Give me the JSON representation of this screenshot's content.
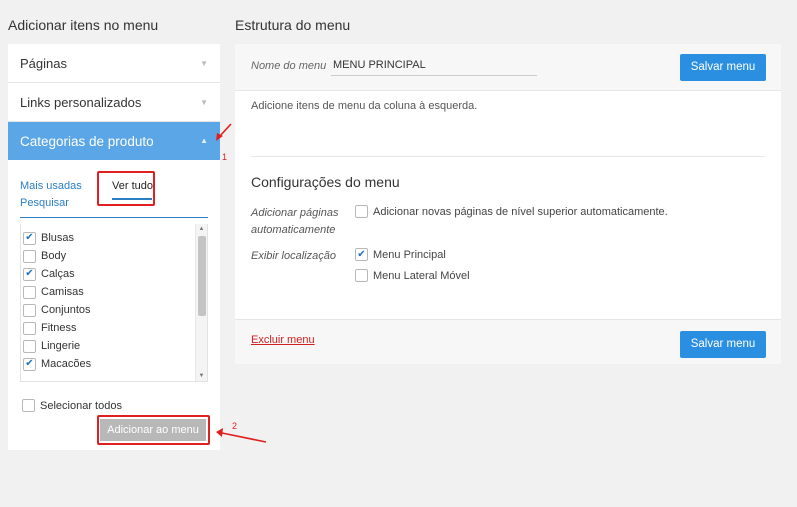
{
  "left": {
    "title": "Adicionar itens no menu",
    "accordion": [
      {
        "label": "Páginas"
      },
      {
        "label": "Links personalizados"
      },
      {
        "label": "Categorias de produto"
      }
    ],
    "tabs": {
      "most_used": "Mais usadas",
      "search": "Pesquisar",
      "view_all": "Ver tudo"
    },
    "categories": [
      {
        "label": "Blusas",
        "checked": true
      },
      {
        "label": "Body",
        "checked": false
      },
      {
        "label": "Calças",
        "checked": true
      },
      {
        "label": "Camisas",
        "checked": false
      },
      {
        "label": "Conjuntos",
        "checked": false
      },
      {
        "label": "Fitness",
        "checked": false
      },
      {
        "label": "Lingerie",
        "checked": false
      },
      {
        "label": "Macacões",
        "checked": true
      }
    ],
    "select_all": "Selecionar todos",
    "add_button": "Adicionar ao menu"
  },
  "right": {
    "title": "Estrutura do menu",
    "name_label": "Nome do menu",
    "name_value": "MENU PRINCIPAL",
    "save_button": "Salvar menu",
    "instructions": "Adicione itens de menu da coluna à esquerda.",
    "settings_title": "Configurações do menu",
    "auto_add_label_line1": "Adicionar páginas",
    "auto_add_label_line2": "automaticamente",
    "auto_add_option": "Adicionar novas páginas de nível superior automaticamente.",
    "location_label": "Exibir localização",
    "locations": [
      {
        "label": "Menu Principal",
        "checked": true
      },
      {
        "label": "Menu Lateral Móvel",
        "checked": false
      }
    ],
    "delete_link": "Excluir menu"
  },
  "annotations": {
    "one": "1",
    "two": "2"
  },
  "colors": {
    "accent": "#5aa6e6",
    "button": "#2a8fe0",
    "highlight": "#e02020",
    "delete": "#d02020"
  }
}
